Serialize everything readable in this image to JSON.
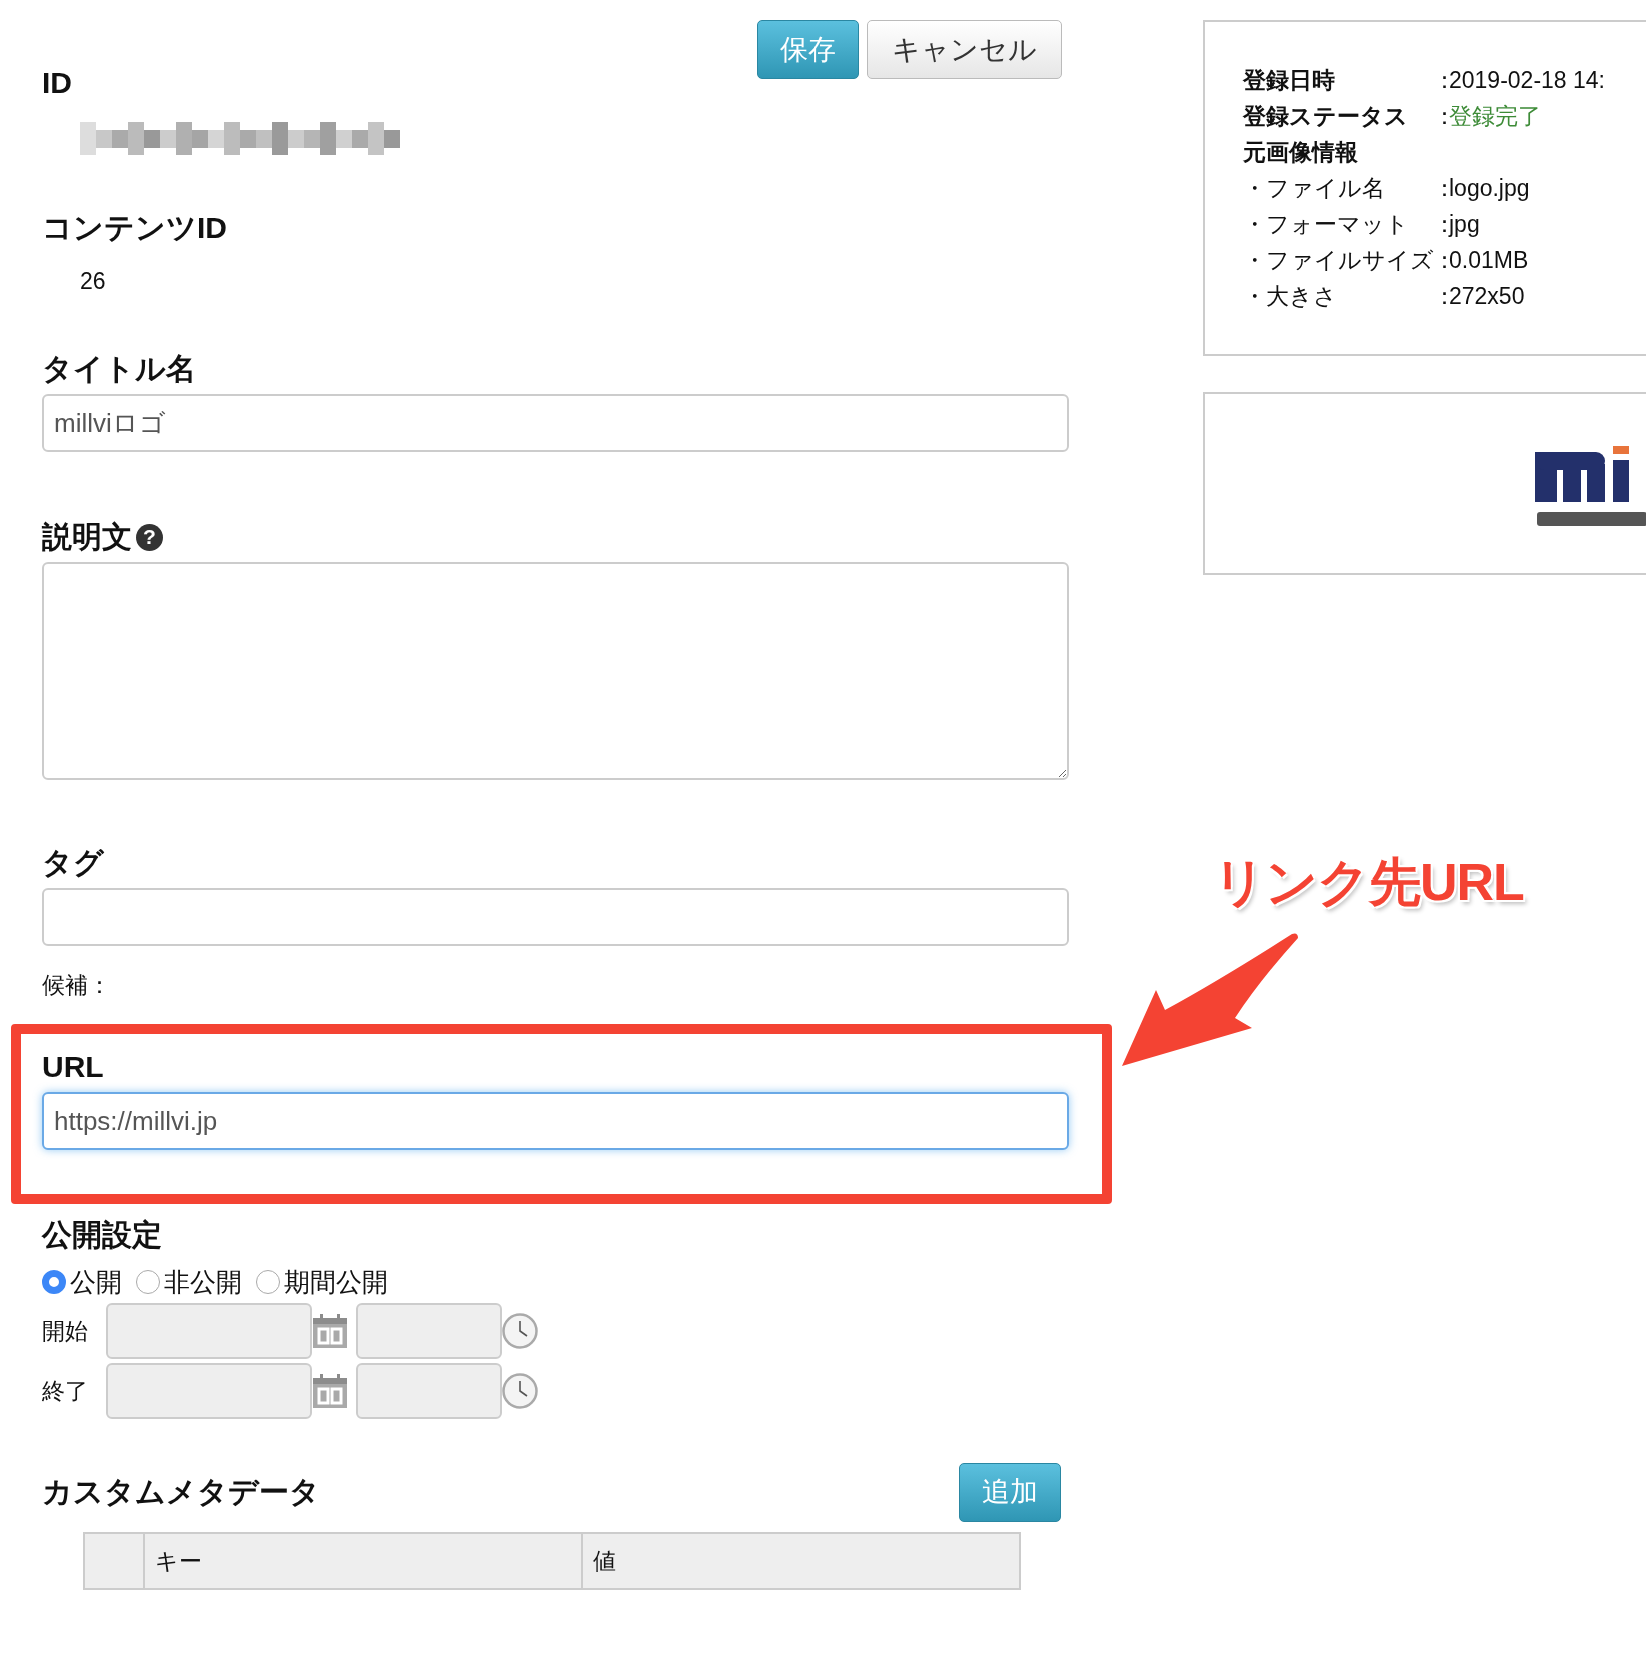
{
  "toolbar": {
    "buttons": [
      {
        "label": "保存",
        "kind": "primary"
      },
      {
        "label": "キャンセル",
        "kind": "default"
      }
    ]
  },
  "fields": [
    {
      "kind": "static",
      "label": "ID",
      "redacted": true
    },
    {
      "kind": "static",
      "label": "コンテンツID",
      "value": "26"
    },
    {
      "kind": "input",
      "label": "タイトル名",
      "value": "millviロゴ"
    },
    {
      "kind": "textarea",
      "label": "説明文",
      "help": "?"
    },
    {
      "kind": "input",
      "label": "タグ"
    },
    {
      "kind": "hint",
      "label": "候補："
    },
    {
      "kind": "input",
      "label": "URL",
      "value": "https://millvi.jp",
      "focused": true,
      "highlighted": true
    }
  ],
  "publish": {
    "label": "公開設定",
    "options": [
      {
        "label": "公開",
        "selected": true
      },
      {
        "label": "非公開",
        "selected": false
      },
      {
        "label": "期間公開",
        "selected": false
      }
    ],
    "periods": [
      {
        "label": "開始"
      },
      {
        "label": "終了"
      }
    ]
  },
  "custom_metadata": {
    "title": "カスタムメタデータ",
    "button": "追加",
    "columns": [
      "キー",
      "値"
    ]
  },
  "info": {
    "rows": [
      {
        "kind": "plain",
        "label": "登録日時",
        "separator": "：",
        "value": "2019-02-18 14:"
      },
      {
        "kind": "status",
        "label": "登録ステータス",
        "separator": "：",
        "value": "登録完了"
      },
      {
        "kind": "heading",
        "label": "元画像情報"
      },
      {
        "kind": "sub",
        "label": "・ファイル名",
        "separator": "：",
        "value": "logo.jpg"
      },
      {
        "kind": "sub",
        "label": "・フォーマット",
        "separator": "：",
        "value": "jpg"
      },
      {
        "kind": "sub",
        "label": "・ファイルサイズ",
        "separator": "：",
        "value": "0.01MB"
      },
      {
        "kind": "sub",
        "label": "・大きさ",
        "separator": "：",
        "value": "272x50"
      }
    ]
  },
  "annotation": {
    "text": "リンク先URL"
  }
}
